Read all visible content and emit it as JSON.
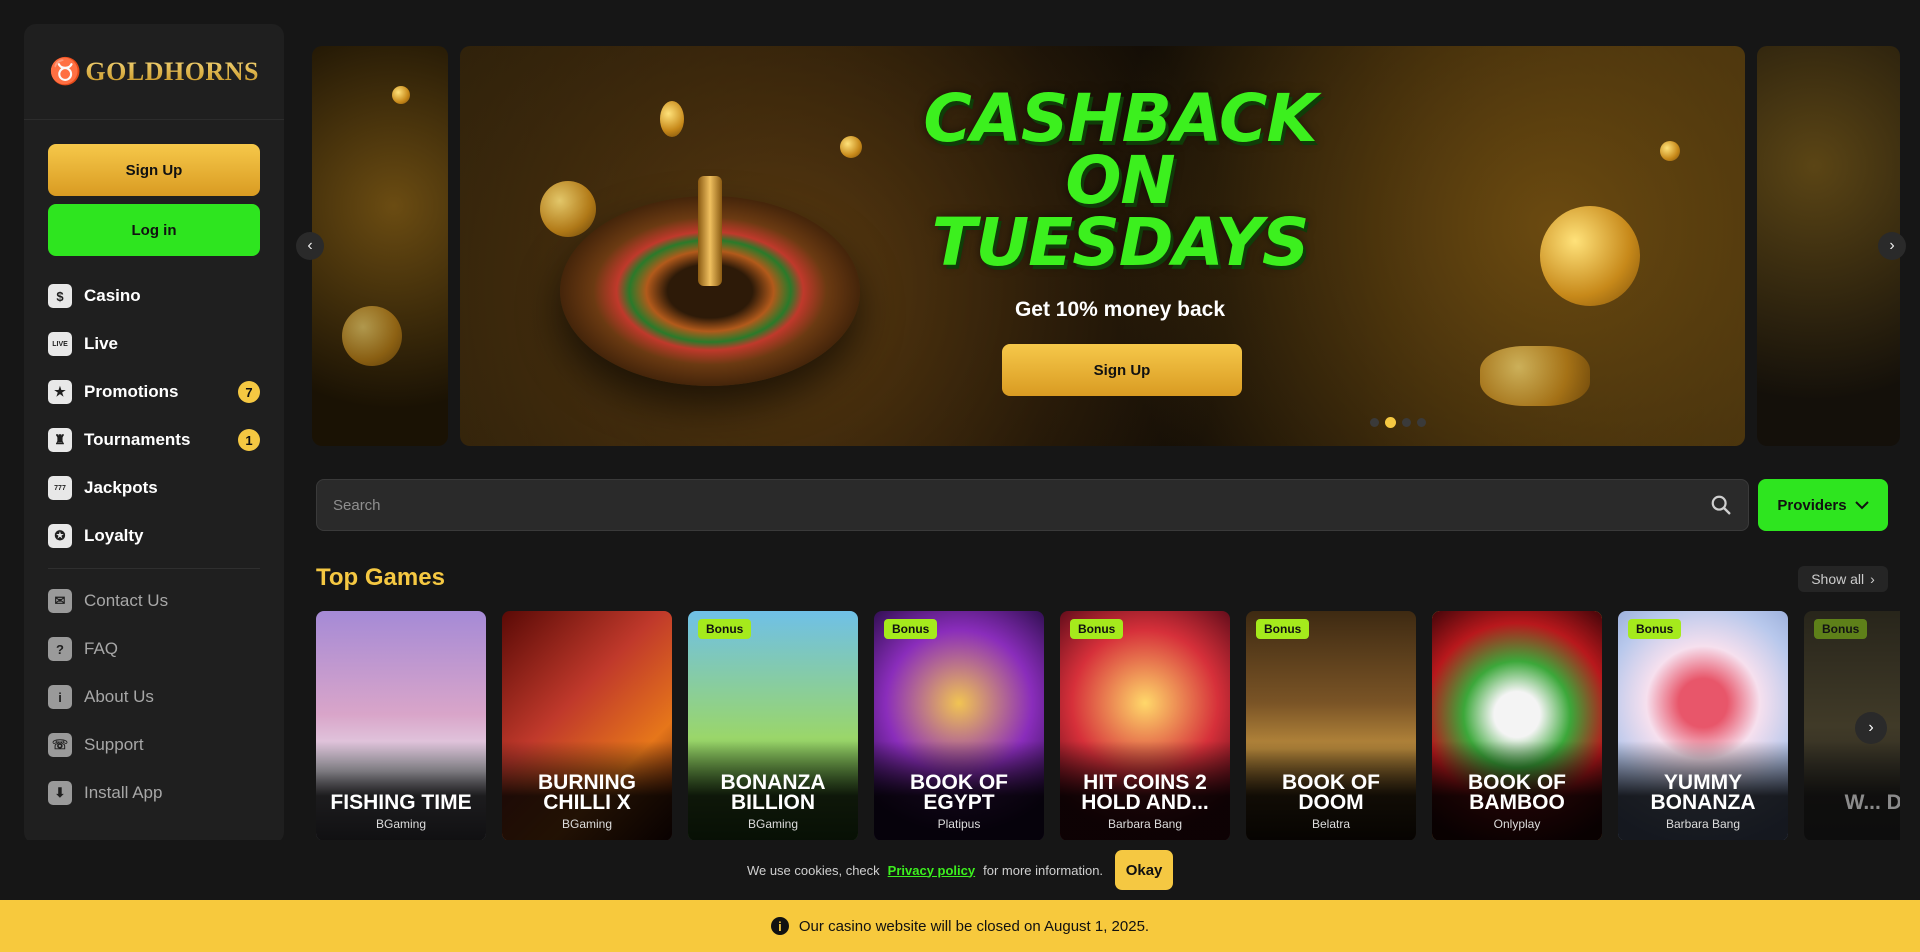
{
  "brand": {
    "name": "GOLDHORNS"
  },
  "auth": {
    "signup_label": "Sign Up",
    "login_label": "Log in"
  },
  "nav": {
    "main": [
      {
        "label": "Casino",
        "icon": "casino-chip-icon",
        "glyph": "$"
      },
      {
        "label": "Live",
        "icon": "live-icon",
        "glyph": "LIVE"
      },
      {
        "label": "Promotions",
        "icon": "promotions-icon",
        "glyph": "★",
        "badge": "7"
      },
      {
        "label": "Tournaments",
        "icon": "trophy-icon",
        "glyph": "♜",
        "badge": "1"
      },
      {
        "label": "Jackpots",
        "icon": "jackpot-icon",
        "glyph": "777"
      },
      {
        "label": "Loyalty",
        "icon": "loyalty-icon",
        "glyph": "✪"
      }
    ],
    "secondary": [
      {
        "label": "Contact Us",
        "icon": "mail-icon",
        "glyph": "✉"
      },
      {
        "label": "FAQ",
        "icon": "faq-icon",
        "glyph": "?"
      },
      {
        "label": "About Us",
        "icon": "about-icon",
        "glyph": "i"
      },
      {
        "label": "Support",
        "icon": "support-icon",
        "glyph": "☏"
      },
      {
        "label": "Install App",
        "icon": "download-icon",
        "glyph": "⬇"
      }
    ]
  },
  "banner": {
    "headline_1": "CASHBACK",
    "headline_2": "ON",
    "headline_3": "TUESDAYS",
    "subline": "Get 10% money back",
    "button_label": "Sign Up",
    "active_slide": 2,
    "slide_count": 4
  },
  "search": {
    "placeholder": "Search",
    "providers_label": "Providers"
  },
  "top_games": {
    "title": "Top Games",
    "show_all": "Show all",
    "games": [
      {
        "title": "FISHING TIME",
        "provider": "BGaming",
        "bonus": ""
      },
      {
        "title": "BURNING CHILLI X",
        "provider": "BGaming",
        "bonus": ""
      },
      {
        "title": "BONANZA BILLION",
        "provider": "BGaming",
        "bonus": "Bonus"
      },
      {
        "title": "BOOK OF EGYPT",
        "provider": "Platipus",
        "bonus": "Bonus"
      },
      {
        "title": "HIT COINS 2 HOLD AND...",
        "provider": "Barbara Bang",
        "bonus": "Bonus"
      },
      {
        "title": "BOOK OF DOOM",
        "provider": "Belatra",
        "bonus": "Bonus"
      },
      {
        "title": "BOOK OF BAMBOO",
        "provider": "Onlyplay",
        "bonus": ""
      },
      {
        "title": "YUMMY BONANZA",
        "provider": "Barbara Bang",
        "bonus": "Bonus"
      },
      {
        "title": "W... DE...",
        "provider": "",
        "bonus": "Bonus"
      }
    ]
  },
  "cookie": {
    "text_before": "We use cookies, check",
    "link": "Privacy policy",
    "text_after": "for more information.",
    "ok_label": "Okay"
  },
  "notice": {
    "text": "Our casino website will be closed on August 1, 2025."
  },
  "colors": {
    "gold": "#f5c842",
    "green": "#2ee51f",
    "bg": "#161616",
    "panel": "#1f1f1f"
  }
}
